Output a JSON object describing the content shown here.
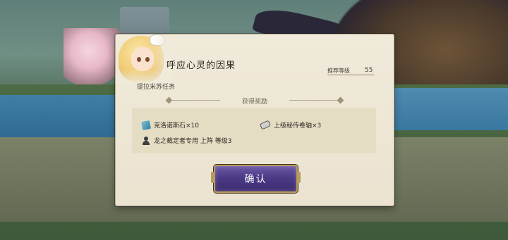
{
  "dialog": {
    "title": "呼应心灵的因果",
    "subtitle": "提拉米苏任务",
    "recommend_label": "推荐等级",
    "recommend_value": "55",
    "rewards_header": "获得奖励",
    "rewards": [
      {
        "icon": "stone-icon",
        "label": "克洛诺斯石×10"
      },
      {
        "icon": "scroll-icon",
        "label": "上级秘传卷轴×3"
      },
      {
        "icon": "person-icon",
        "label": "龙之裁定者专用 上阵 等级3"
      }
    ],
    "confirm_label": "确认"
  }
}
